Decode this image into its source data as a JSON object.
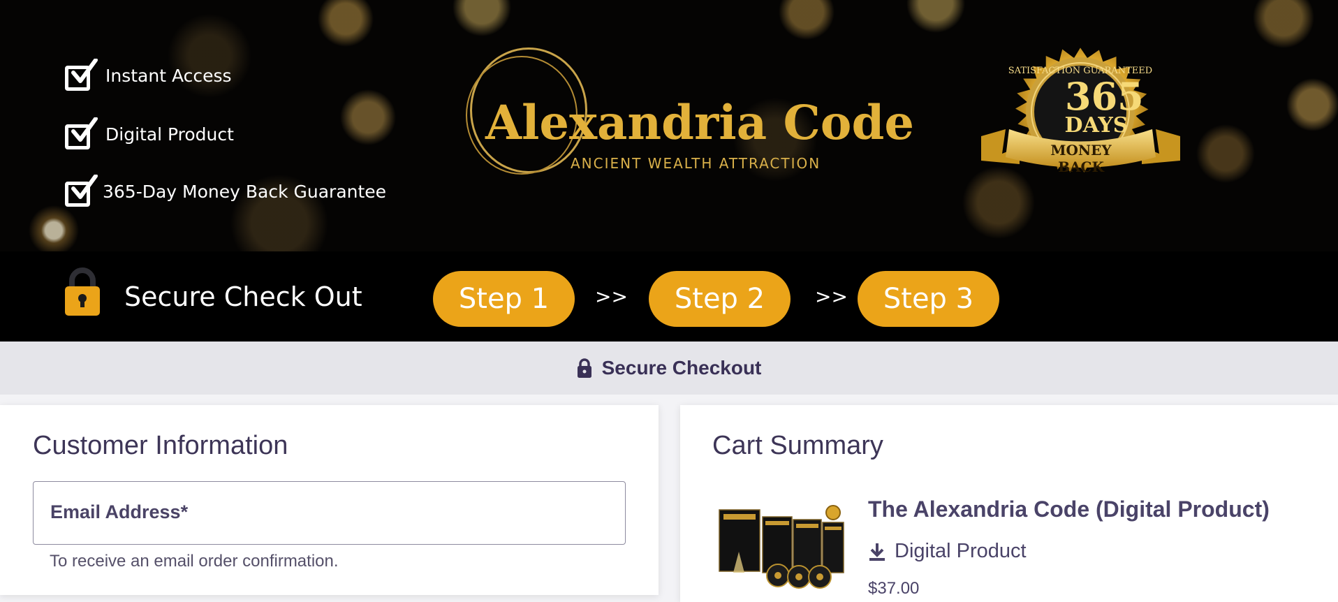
{
  "banner": {
    "features": [
      "Instant Access",
      "Digital Product",
      "365-Day Money Back Guarantee"
    ],
    "logo": {
      "title": "Alexandria Code",
      "subtitle": "ANCIENT WEALTH ATTRACTION"
    },
    "seal": {
      "arc_text": "SATISFACTION GUARANTEED",
      "days_number": "365",
      "days_word": "DAYS",
      "ribbon": "MONEY BACK"
    },
    "secure_label": "Secure Check Out",
    "steps": [
      "Step 1",
      "Step 2",
      "Step 3"
    ],
    "step_separator": ">>"
  },
  "secure_bar": {
    "label": "Secure Checkout",
    "icon": "lock-icon"
  },
  "customer": {
    "title": "Customer Information",
    "email_label": "Email Address*",
    "email_value": "",
    "email_help": "To receive an email order confirmation."
  },
  "cart": {
    "title": "Cart Summary",
    "item": {
      "name": "The Alexandria Code (Digital Product)",
      "type": "Digital Product",
      "type_icon": "download-icon",
      "price": "$37.00"
    }
  },
  "colors": {
    "step_orange": "#eba419",
    "gold": "#e2b13a",
    "text_dark": "#3d3557",
    "bar_bg": "#e5e5ea"
  }
}
